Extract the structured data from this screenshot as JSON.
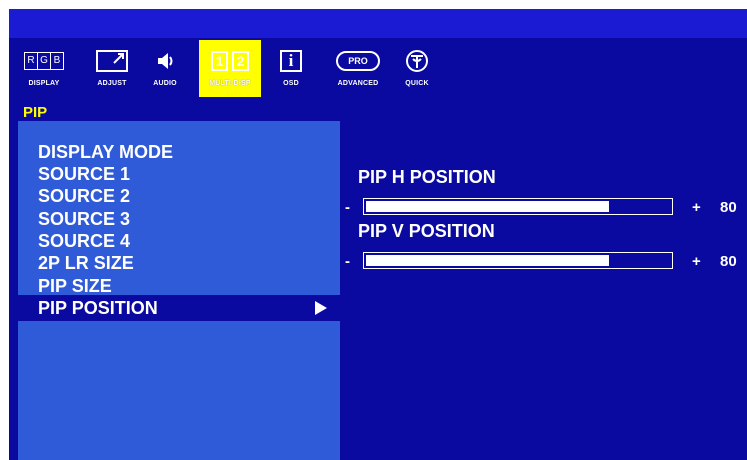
{
  "tabs": [
    {
      "label": "DISPLAY",
      "icon": "rgb-icon"
    },
    {
      "label": "ADJUST",
      "icon": "adjust-icon"
    },
    {
      "label": "AUDIO",
      "icon": "speaker-icon"
    },
    {
      "label": "MULTI-DISP",
      "icon": "multi-display-icon",
      "active": true,
      "icon_text": [
        "1",
        "2"
      ]
    },
    {
      "label": "OSD",
      "icon": "info-icon",
      "icon_text": "i"
    },
    {
      "label": "ADVANCED",
      "icon": "pro-icon",
      "icon_text": "PRO"
    },
    {
      "label": "QUICK",
      "icon": "quick-icon"
    }
  ],
  "rgb_icon_letters": [
    "R",
    "G",
    "B"
  ],
  "section_title": "PIP",
  "menu": {
    "items": [
      "DISPLAY MODE",
      "SOURCE 1",
      "SOURCE 2",
      "SOURCE 3",
      "SOURCE 4",
      "2P LR SIZE",
      "PIP SIZE",
      "PIP POSITION"
    ],
    "selected_index": 7
  },
  "settings": [
    {
      "label": "PIP H POSITION",
      "minus": "-",
      "plus": "+",
      "value": "80",
      "level": 0.8
    },
    {
      "label": "PIP V POSITION",
      "minus": "-",
      "plus": "+",
      "value": "80",
      "level": 0.8
    }
  ],
  "colors": {
    "background": "#0a0aa0",
    "menu_panel": "#2f5ad8",
    "top_strip": "#1b1bd4",
    "active_tab": "#ffff00",
    "title_text": "#ffff00",
    "text": "#ffffff"
  }
}
